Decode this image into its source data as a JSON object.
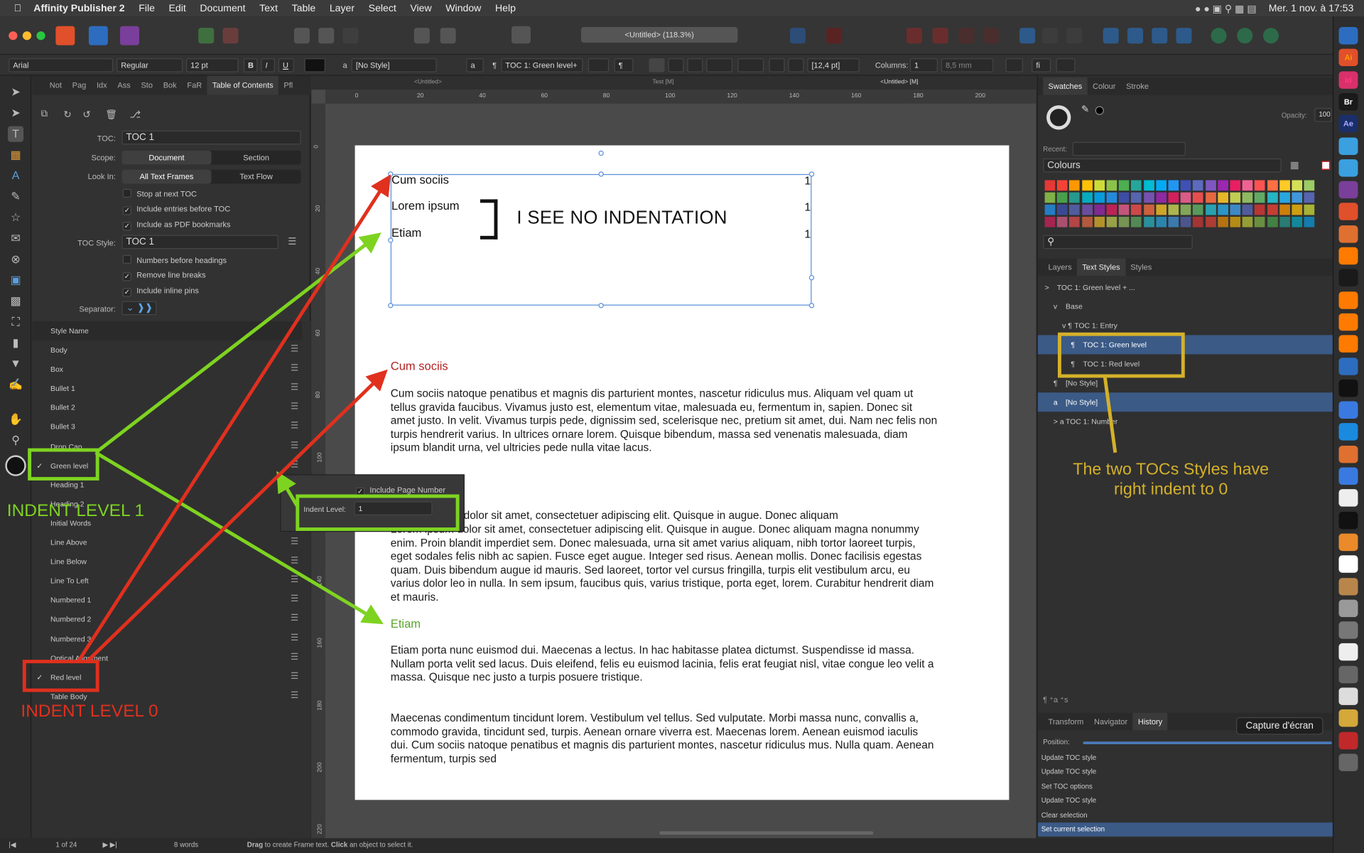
{
  "menubar": {
    "app": "Affinity Publisher 2",
    "items": [
      "File",
      "Edit",
      "Document",
      "Text",
      "Table",
      "Layer",
      "Select",
      "View",
      "Window",
      "Help"
    ],
    "clock": "Mer. 1 nov. à 17:53"
  },
  "toolbar": {
    "doc_title": "<Untitled> (118.3%)"
  },
  "context": {
    "font": "Arial",
    "weight": "Regular",
    "size": "12 pt",
    "char_style": "[No Style]",
    "para_style": "TOC 1: Green level+",
    "leading": "[12,4 pt]",
    "columns_label": "Columns:",
    "columns": "1",
    "gutter": "8,5 mm"
  },
  "left_studio": {
    "tabs": [
      "Not",
      "Pag",
      "Idx",
      "Ass",
      "Sto",
      "Bok",
      "FaR",
      "Table of Contents",
      "Pfl"
    ],
    "toc_label": "TOC:",
    "toc_value": "TOC 1",
    "scope_label": "Scope:",
    "scope_options": [
      "Document",
      "Section"
    ],
    "lookin_label": "Look In:",
    "lookin_options": [
      "All Text Frames",
      "Text Flow"
    ],
    "checks1": [
      {
        "label": "Stop at next TOC",
        "on": false
      },
      {
        "label": "Include entries before TOC",
        "on": true
      },
      {
        "label": "Include as PDF bookmarks",
        "on": true
      }
    ],
    "tocstyle_label": "TOC Style:",
    "tocstyle_value": "TOC 1",
    "checks2": [
      {
        "label": "Numbers before headings",
        "on": false
      },
      {
        "label": "Remove line breaks",
        "on": true
      },
      {
        "label": "Include inline pins",
        "on": true
      }
    ],
    "separator_label": "Separator:",
    "style_header": "Style Name",
    "styles": [
      {
        "name": "Body",
        "on": false
      },
      {
        "name": "Box",
        "on": false
      },
      {
        "name": "Bullet 1",
        "on": false
      },
      {
        "name": "Bullet 2",
        "on": false
      },
      {
        "name": "Bullet 3",
        "on": false
      },
      {
        "name": "Drop Cap",
        "on": false
      },
      {
        "name": "Green level",
        "on": true
      },
      {
        "name": "Heading 1",
        "on": false
      },
      {
        "name": "Heading 2",
        "on": false
      },
      {
        "name": "Initial Words",
        "on": false
      },
      {
        "name": "Line Above",
        "on": false
      },
      {
        "name": "Line Below",
        "on": false
      },
      {
        "name": "Line To Left",
        "on": false
      },
      {
        "name": "Numbered 1",
        "on": false
      },
      {
        "name": "Numbered 2",
        "on": false
      },
      {
        "name": "Numbered 3",
        "on": false
      },
      {
        "name": "Optical Alignment",
        "on": false
      },
      {
        "name": "Red level",
        "on": true
      },
      {
        "name": "Table Body",
        "on": false
      }
    ]
  },
  "popup": {
    "include_page_number": "Include Page Number",
    "indent_label": "Indent Level:",
    "indent_value": "1"
  },
  "canvas": {
    "doc_tabs": [
      "<Untitled>",
      "Test [M]",
      "<Untitled> [M]"
    ],
    "ruler_h": [
      "0",
      "20",
      "40",
      "60",
      "80",
      "100",
      "120",
      "140",
      "160",
      "180",
      "200"
    ],
    "ruler_v": [
      "0",
      "20",
      "40",
      "60",
      "80",
      "100",
      "120",
      "140",
      "160",
      "180",
      "200",
      "220"
    ],
    "toc": [
      {
        "text": "Cum sociis",
        "page": "1"
      },
      {
        "text": "Lorem ipsum",
        "page": "1"
      },
      {
        "text": "Etiam",
        "page": "1"
      }
    ],
    "callout": "I SEE NO INDENTATION",
    "heading1": "Cum sociis",
    "para1": "Cum sociis natoque penatibus et magnis dis parturient montes, nascetur ridiculus mus. Aliquam vel quam ut tellus gravida faucibus. Vivamus justo est, elementum vitae, malesuada eu, fermentum in, sapien. Donec sit amet justo. In velit. Vivamus turpis pede, dignissim sed, scelerisque nec, pretium sit amet, dui. Nam nec felis non turpis hendrerit varius. In ultrices ornare lorem. Quisque bibendum, massa sed venenatis malesuada, diam ipsum blandit urna, vel ultricies pede nulla vitae lacus.",
    "para2": "Lorem ipsum dolor sit amet, consectetuer adipiscing elit. Quisque in augue. Donec aliquam magna nonummy enim. Proin blandit imperdiet sem. Donec malesuada, urna sit amet varius aliquam, nibh tortor laoreet turpis, eget sodales felis  nibh ac sapien. Fusce eget augue. Integer sed risus. Aenean mollis. Donec facilisis egestas quam. Duis bibendum augue  id mauris. Sed laoreet, tortor vel cursus fringilla, turpis elit vestibulum arcu, eu varius dolor leo in nulla. In sem ipsum, faucibus quis, varius tristique, porta eget, lorem. Curabitur hendrerit diam et mauris.",
    "para2_visible_start": "dolor sit amet, consectetuer adipiscing elit. Quisque in augue. Donec aliquam",
    "heading3": "Etiam",
    "para3": "Etiam porta nunc euismod dui. Maecenas a lectus. In hac habitasse platea dictumst. Suspendisse id massa. Nullam porta velit sed lacus. Duis eleifend, felis eu euismod lacinia, felis erat feugiat nisl, vitae congue leo velit a massa. Quisque nec justo a turpis posuere tristique.",
    "para4": "Maecenas condimentum tincidunt lorem. Vestibulum vel tellus. Sed vulputate. Morbi massa nunc, convallis a, commodo gravida, tincidunt sed, turpis. Aenean ornare viverra est. Maecenas lorem. Aenean euismod iaculis dui. Cum sociis natoque penatibus et magnis dis parturient montes, nascetur ridiculus mus. Nulla quam. Aenean fermentum, turpis sed"
  },
  "right_studio": {
    "top_tabs": [
      "Swatches",
      "Colour",
      "Stroke"
    ],
    "opacity_label": "Opacity:",
    "opacity": "100",
    "recent_label": "Recent:",
    "palette": "Colours",
    "mid_tabs": [
      "Layers",
      "Text Styles",
      "Styles"
    ],
    "styles_tree": [
      {
        "label": "TOC 1: Green level + ...",
        "indent": 0,
        "icon": ">"
      },
      {
        "label": "Base",
        "indent": 1,
        "icon": "v"
      },
      {
        "label": "TOC 1: Entry",
        "indent": 2,
        "icon": "v ¶"
      },
      {
        "label": "TOC 1: Green level",
        "indent": 3,
        "icon": "¶",
        "sel": true
      },
      {
        "label": "TOC 1: Red level",
        "indent": 3,
        "icon": "¶"
      },
      {
        "label": "[No Style]",
        "indent": 1,
        "icon": "¶"
      },
      {
        "label": "[No Style]",
        "indent": 1,
        "icon": "a",
        "sel": true
      },
      {
        "label": "TOC 1: Number",
        "indent": 1,
        "icon": "> a"
      }
    ],
    "note": "The two TOCs Styles have right indent to 0",
    "bottom_tabs": [
      "Transform",
      "Navigator",
      "History"
    ],
    "capture": "Capture d'écran",
    "position_label": "Position:",
    "history": [
      "Update TOC style",
      "Update TOC style",
      "Set TOC options",
      "Update TOC style",
      "Clear selection",
      "Set current selection"
    ]
  },
  "annotations": {
    "indent1": "INDENT LEVEL 1",
    "indent0": "INDENT LEVEL 0"
  },
  "status": {
    "pages": "1 of 24",
    "words": "8 words",
    "hint_b1": "Drag",
    "hint_1": " to create Frame text. ",
    "hint_b2": "Click",
    "hint_2": " an object to select it."
  },
  "colors": {
    "green": "#7ed321",
    "red": "#e0301e",
    "yellow": "#d4b12a",
    "heading_red": "#b22222",
    "heading_green": "#5aa52a",
    "selection": "#3b5a86"
  }
}
